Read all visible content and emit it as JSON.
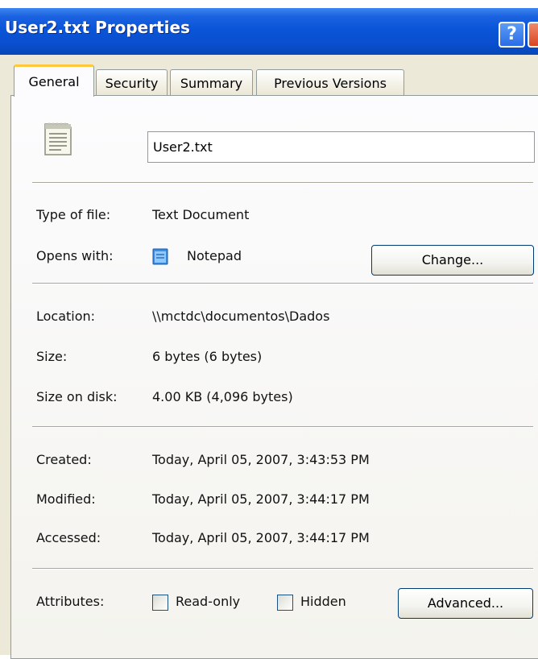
{
  "window": {
    "title": "User2.txt Properties",
    "help_glyph": "?"
  },
  "tabs": [
    {
      "label": "General",
      "active": true
    },
    {
      "label": "Security",
      "active": false
    },
    {
      "label": "Summary",
      "active": false
    },
    {
      "label": "Previous Versions",
      "active": false
    }
  ],
  "general": {
    "file_icon": "text-file-icon",
    "file_name": "User2.txt",
    "type_label": "Type of file:",
    "type_value": "Text Document",
    "opens_label": "Opens with:",
    "opens_icon": "notepad-icon",
    "opens_value": "Notepad",
    "change_button": "Change...",
    "location_label": "Location:",
    "location_value": "\\\\mctdc\\documentos\\Dados",
    "size_label": "Size:",
    "size_value": "6 bytes (6 bytes)",
    "size_disk_label": "Size on disk:",
    "size_disk_value": "4.00 KB (4,096 bytes)",
    "created_label": "Created:",
    "created_value": "Today, April 05, 2007, 3:43:53 PM",
    "modified_label": "Modified:",
    "modified_value": "Today, April 05, 2007, 3:44:17 PM",
    "accessed_label": "Accessed:",
    "accessed_value": "Today, April 05, 2007, 3:44:17 PM",
    "attributes_label": "Attributes:",
    "readonly_label": "Read-only",
    "readonly_checked": false,
    "hidden_label": "Hidden",
    "hidden_checked": false,
    "advanced_button": "Advanced..."
  },
  "colors": {
    "titlebar": "#0a55d8",
    "dialog_bg": "#ece9d8",
    "active_tab_accent": "#ffc83c"
  }
}
